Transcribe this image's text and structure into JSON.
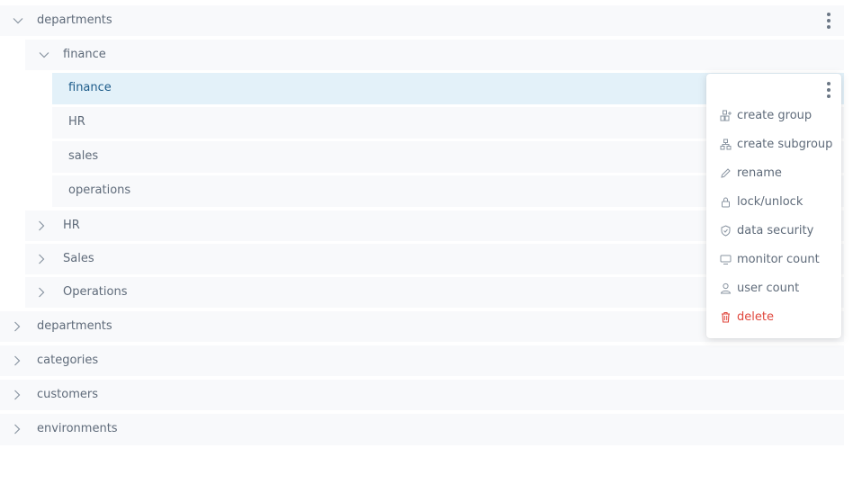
{
  "tree": {
    "root_departments_expanded": "departments",
    "finance_group": "finance",
    "finance_children": [
      "finance",
      "HR",
      "sales",
      "operations"
    ],
    "hr_group": "HR",
    "sales_group": "Sales",
    "operations_group": "Operations",
    "root_departments": "departments",
    "root_categories": "categories",
    "root_customers": "customers",
    "root_environments": "environments"
  },
  "context_menu": {
    "items": [
      {
        "label": "create group",
        "icon": "create-group-icon"
      },
      {
        "label": "create subgroup",
        "icon": "create-subgroup-icon"
      },
      {
        "label": "rename",
        "icon": "pencil-icon"
      },
      {
        "label": "lock/unlock",
        "icon": "lock-icon"
      },
      {
        "label": "data security",
        "icon": "shield-icon"
      },
      {
        "label": "monitor count",
        "icon": "monitor-icon"
      },
      {
        "label": "user count",
        "icon": "user-icon"
      },
      {
        "label": "delete",
        "icon": "trash-icon"
      }
    ]
  },
  "colors": {
    "row_bg": "#f8f9fb",
    "selected_bg": "#e3f1f9",
    "selected_text": "#1d5c8a",
    "text": "#5f6b7a",
    "danger": "#e0473d"
  }
}
